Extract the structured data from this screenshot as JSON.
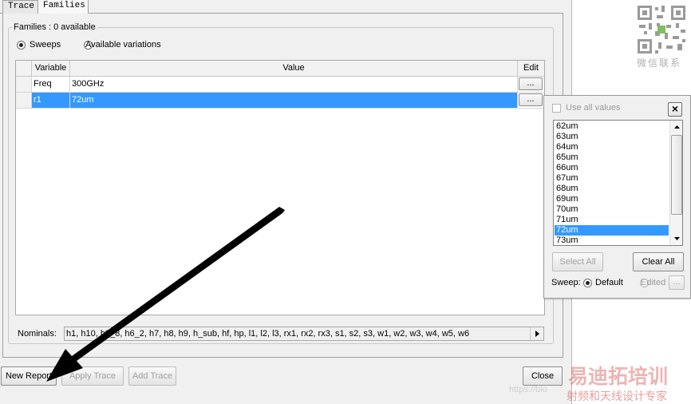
{
  "tabs": [
    {
      "label": "Trace",
      "active": false
    },
    {
      "label": "Families",
      "active": true
    }
  ],
  "families_group": {
    "title": "Families : 0 available",
    "radio_sweeps": "Sweeps",
    "radio_available_variations": "Available variations",
    "selected": "Sweeps"
  },
  "table": {
    "headers": {
      "variable": "Variable",
      "value": "Value",
      "edit": "Edit"
    },
    "rows": [
      {
        "variable": "Freq",
        "value": "300GHz",
        "edit": "...",
        "selected": false
      },
      {
        "variable": "r1",
        "value": "72um",
        "edit": "...",
        "selected": true
      }
    ]
  },
  "nominals": {
    "label": "Nominals:",
    "value": "h1, h10, h2_8, h6_2, h7, h8, h9, h_sub, hf, hp, l1, l2, l3, rx1, rx2, rx3, s1, s2, s3, w1, w2, w3, w4, w5, w6"
  },
  "buttons": {
    "new_report": "New Report",
    "apply_trace": "Apply Trace",
    "add_trace": "Add Trace",
    "close": "Close"
  },
  "popup": {
    "use_all_values": "Use all values",
    "close": "×",
    "items": [
      "62um",
      "63um",
      "64um",
      "65um",
      "66um",
      "67um",
      "68um",
      "69um",
      "70um",
      "71um",
      "72um",
      "73um"
    ],
    "selected_item": "72um",
    "select_all": "Select All",
    "clear_all": "Clear All",
    "sweep_label": "Sweep:",
    "sweep_default": "Default",
    "sweep_edited": "Edited",
    "edited_button": "..."
  },
  "watermark": {
    "qr_caption": "微信联系",
    "brand_title": "易迪拓培训",
    "brand_subtitle": "射频和天线设计专家",
    "url_fragment": "https://blo"
  },
  "colors": {
    "selection": "#3399ff",
    "dialog_bg": "#f0f0f0",
    "watermark": "#cc2a2a",
    "arrow": "#000000"
  }
}
